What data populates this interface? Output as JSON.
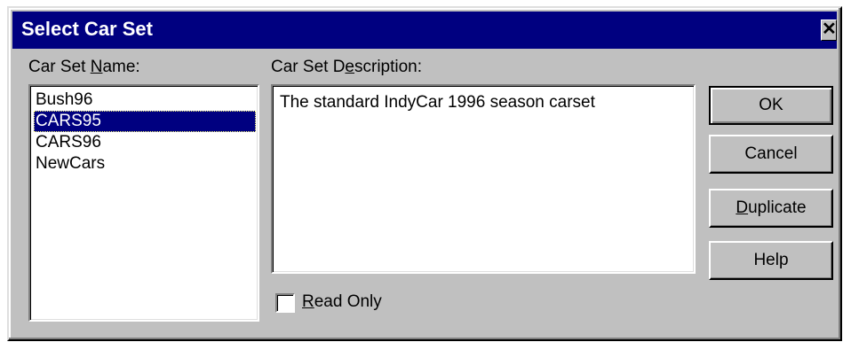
{
  "window": {
    "title": "Select Car Set",
    "close_glyph": "✕"
  },
  "car_set_name": {
    "label_before": "Car Set ",
    "label_underline": "N",
    "label_after": "ame:",
    "items": [
      "Bush96",
      "CARS95",
      "CARS96",
      "NewCars"
    ],
    "selected": "CARS95"
  },
  "car_set_description": {
    "label_before": "Car Set D",
    "label_underline": "e",
    "label_after": "scription:",
    "value": "The standard IndyCar 1996 season carset"
  },
  "read_only": {
    "label_underline": "R",
    "label_after": "ead Only",
    "checked": false
  },
  "buttons": {
    "ok": "OK",
    "cancel": "Cancel",
    "duplicate_underline": "D",
    "duplicate_after": "uplicate",
    "help": "Help"
  },
  "colors": {
    "titlebar": "#000080",
    "face": "#c0c0c0",
    "selection": "#000080"
  }
}
